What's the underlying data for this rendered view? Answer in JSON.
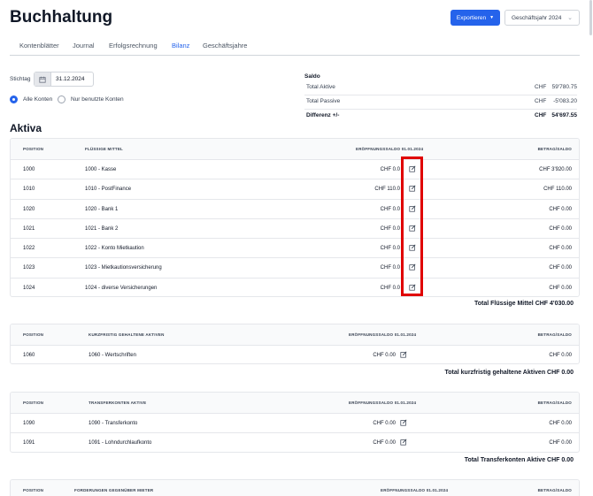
{
  "header": {
    "title": "Buchhaltung",
    "export_label": "Exportieren",
    "year_label": "Geschäftsjahr 2024"
  },
  "tabs": [
    {
      "label": "Kontenblätter"
    },
    {
      "label": "Journal"
    },
    {
      "label": "Erfolgsrechnung"
    },
    {
      "label": "Bilanz",
      "active": true
    },
    {
      "label": "Geschäftsjahre"
    }
  ],
  "filters": {
    "stichtag_label": "Stichtag",
    "date_value": "31.12.2024",
    "radio_all": "Alle Konten",
    "radio_used": "Nur benutzte Konten",
    "selected": "all"
  },
  "saldo": {
    "title": "Saldo",
    "rows": [
      {
        "label": "Total Aktive",
        "currency": "CHF",
        "amount": "59'780.75"
      },
      {
        "label": "Total Passive",
        "currency": "CHF",
        "amount": "-5'083.20"
      },
      {
        "label": "Differenz +/-",
        "currency": "CHF",
        "amount": "54'697.55"
      }
    ]
  },
  "section_title": "Aktiva",
  "groups": [
    {
      "headers": {
        "position": "POSITION",
        "name": "FLÜSSIGE MITTEL",
        "opening": "ERÖFFNUNGSSALDO 01.01.2024",
        "balance": "BETRAG/SALDO"
      },
      "rows": [
        {
          "position": "1000",
          "name": "1000 - Kasse",
          "opening": "CHF 0.0",
          "balance": "CHF 3'920.00"
        },
        {
          "position": "1010",
          "name": "1010 - PostFinance",
          "opening": "CHF 110.0",
          "balance": "CHF 110.00"
        },
        {
          "position": "1020",
          "name": "1020 - Bank 1",
          "opening": "CHF 0.0",
          "balance": "CHF 0.00"
        },
        {
          "position": "1021",
          "name": "1021 - Bank 2",
          "opening": "CHF 0.0",
          "balance": "CHF 0.00"
        },
        {
          "position": "1022",
          "name": "1022 - Konto Mietkaution",
          "opening": "CHF 0.0",
          "balance": "CHF 0.00"
        },
        {
          "position": "1023",
          "name": "1023 - Mietkautionsversicherung",
          "opening": "CHF 0.0",
          "balance": "CHF 0.00"
        },
        {
          "position": "1024",
          "name": "1024 - diverse Versicherungen",
          "opening": "CHF 0.0",
          "balance": "CHF 0.00"
        }
      ],
      "total": "Total Flüssige Mittel   CHF 4'030.00"
    },
    {
      "headers": {
        "position": "POSITION",
        "name": "KURZFRISTIG GEHALTENE AKTIVEN",
        "opening": "ERÖFFNUNGSSALDO 01.01.2024",
        "balance": "BETRAG/SALDO"
      },
      "rows": [
        {
          "position": "1060",
          "name": "1060 - Wertschriften",
          "opening": "CHF 0.00",
          "balance": "CHF 0.00"
        }
      ],
      "total": "Total kurzfristig gehaltene Aktiven   CHF 0.00"
    },
    {
      "headers": {
        "position": "POSITION",
        "name": "TRANSFERKONTEN AKTIVE",
        "opening": "ERÖFFNUNGSSALDO 01.01.2024",
        "balance": "BETRAG/SALDO"
      },
      "rows": [
        {
          "position": "1090",
          "name": "1090 - Transferkonto",
          "opening": "CHF 0.00",
          "balance": "CHF 0.00"
        },
        {
          "position": "1091",
          "name": "1091 - Lohndurchlaufkonto",
          "opening": "CHF 0.00",
          "balance": "CHF 0.00"
        }
      ],
      "total": "Total Transferkonten Aktive   CHF 0.00"
    },
    {
      "headers": {
        "position": "POSITION",
        "name": "FORDERUNGEN GEGENÜBER MIETER",
        "opening": "ERÖFFNUNGSSALDO 01.01.2024",
        "balance": "BETRAG/SALDO"
      },
      "rows": [],
      "total": ""
    }
  ],
  "colors": {
    "accent": "#2563eb",
    "highlight": "#e00000"
  },
  "icons": {
    "edit": "edit-icon",
    "calendar": "calendar-icon",
    "dropdown": "chevron-down-icon"
  }
}
